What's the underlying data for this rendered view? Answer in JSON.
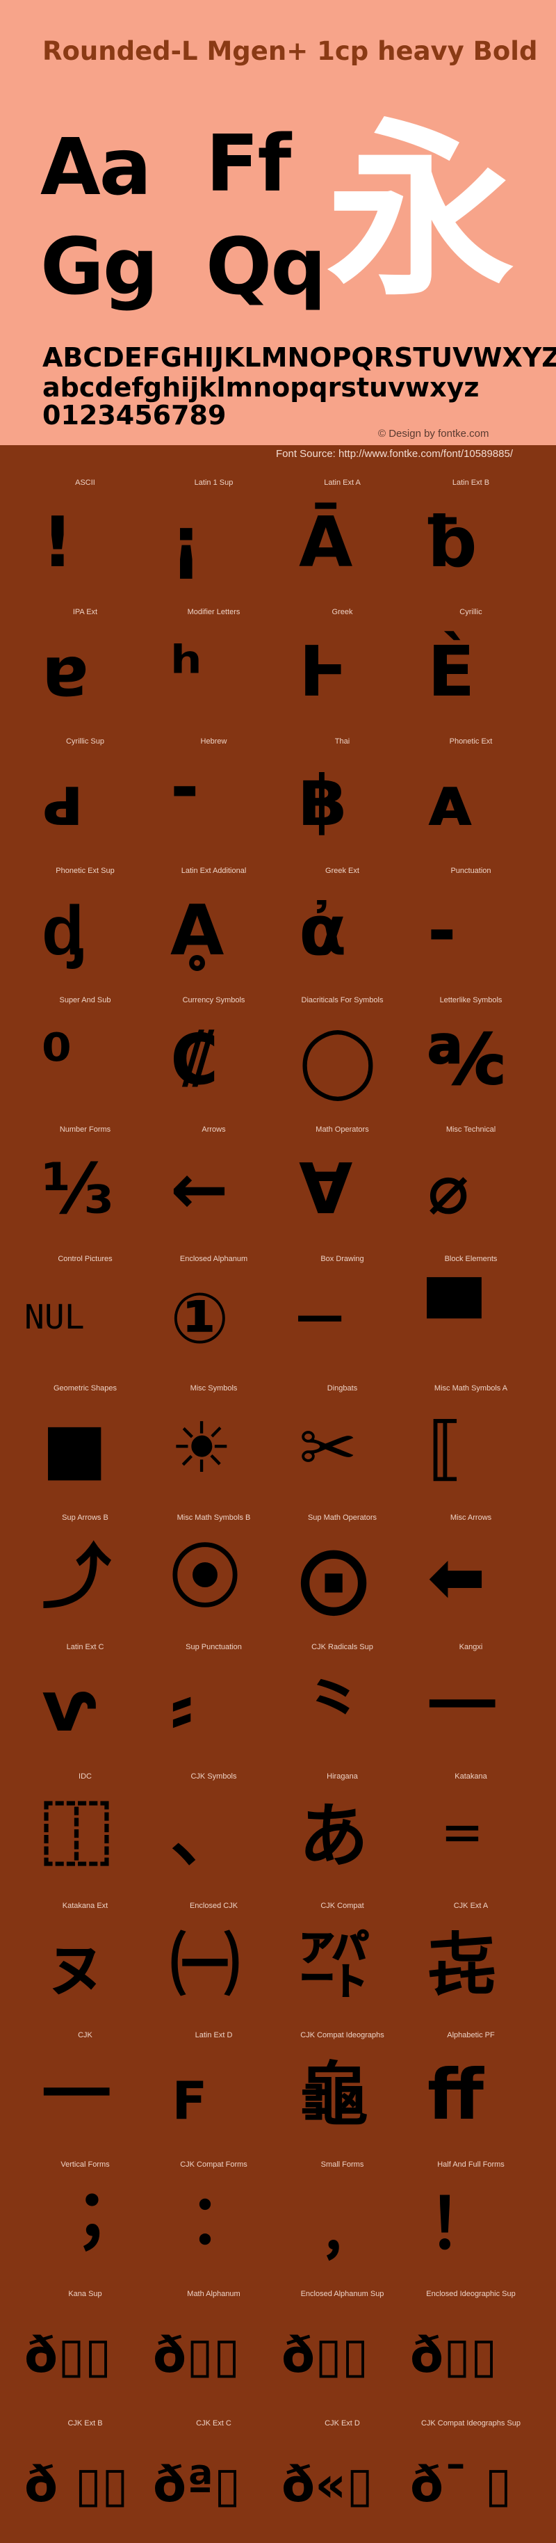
{
  "header": {
    "title": "Rounded-L Mgen+ 1cp heavy Bold",
    "samples": [
      "Aa",
      "Ff",
      "Gg",
      "Qq"
    ],
    "cjk_sample": "永",
    "uppercase": "ABCDEFGHIJKLMNOPQRSTUVWXYZ",
    "lowercase": "abcdefghijklmnopqrstuvwxyz",
    "digits": "0123456789",
    "credit": "© Design by fontke.com",
    "source": "Font Source: http://www.fontke.com/font/10589885/"
  },
  "colors": {
    "header_bg": "#F7A48A",
    "body_bg": "#843513",
    "title": "#8A3A15",
    "cjk_sample": "#FFFFFF"
  },
  "blocks": [
    {
      "label": "ASCII",
      "glyph": "!"
    },
    {
      "label": "Latin 1 Sup",
      "glyph": "¡"
    },
    {
      "label": "Latin Ext A",
      "glyph": "Ā"
    },
    {
      "label": "Latin Ext B",
      "glyph": "ƀ"
    },
    {
      "label": "IPA Ext",
      "glyph": "ɐ"
    },
    {
      "label": "Modifier Letters",
      "glyph": "ʰ"
    },
    {
      "label": "Greek",
      "glyph": "Ͱ"
    },
    {
      "label": "Cyrillic",
      "glyph": "Ѐ"
    },
    {
      "label": "Cyrillic Sup",
      "glyph": "ԁ"
    },
    {
      "label": "Hebrew",
      "glyph": "־"
    },
    {
      "label": "Thai",
      "glyph": "฿"
    },
    {
      "label": "Phonetic Ext",
      "glyph": "ᴀ"
    },
    {
      "label": "Phonetic Ext Sup",
      "glyph": "ᶁ"
    },
    {
      "label": "Latin Ext Additional",
      "glyph": "Ḁ"
    },
    {
      "label": "Greek Ext",
      "glyph": "ἀ"
    },
    {
      "label": "Punctuation",
      "glyph": "‐"
    },
    {
      "label": "Super And Sub",
      "glyph": "⁰"
    },
    {
      "label": "Currency Symbols",
      "glyph": "₡"
    },
    {
      "label": "Diacriticals For Symbols",
      "glyph": "◯"
    },
    {
      "label": "Letterlike Symbols",
      "glyph": "℀"
    },
    {
      "label": "Number Forms",
      "glyph": "⅓"
    },
    {
      "label": "Arrows",
      "glyph": "←"
    },
    {
      "label": "Math Operators",
      "glyph": "∀"
    },
    {
      "label": "Misc Technical",
      "glyph": "⌀"
    },
    {
      "label": "Control Pictures",
      "glyph": "NUL"
    },
    {
      "label": "Enclosed Alphanum",
      "glyph": "①"
    },
    {
      "label": "Box Drawing",
      "glyph": "─"
    },
    {
      "label": "Block Elements",
      "glyph": "▀"
    },
    {
      "label": "Geometric Shapes",
      "glyph": "■"
    },
    {
      "label": "Misc Symbols",
      "glyph": "☀"
    },
    {
      "label": "Dingbats",
      "glyph": "✂"
    },
    {
      "label": "Misc Math Symbols A",
      "glyph": "⟦"
    },
    {
      "label": "Sup Arrows B",
      "glyph": "⤴"
    },
    {
      "label": "Misc Math Symbols B",
      "glyph": "⦿"
    },
    {
      "label": "Sup Math Operators",
      "glyph": "⨀"
    },
    {
      "label": "Misc Arrows",
      "glyph": "⬅"
    },
    {
      "label": "Latin Ext C",
      "glyph": "ⱱ"
    },
    {
      "label": "Sup Punctuation",
      "glyph": "⸗"
    },
    {
      "label": "CJK Radicals Sup",
      "glyph": "⺀"
    },
    {
      "label": "Kangxi",
      "glyph": "⼀"
    },
    {
      "label": "IDC",
      "glyph": "⿰"
    },
    {
      "label": "CJK Symbols",
      "glyph": "、"
    },
    {
      "label": "Hiragana",
      "glyph": "あ"
    },
    {
      "label": "Katakana",
      "glyph": "゠"
    },
    {
      "label": "Katakana Ext",
      "glyph": "ㇴ"
    },
    {
      "label": "Enclosed CJK",
      "glyph": "㈠"
    },
    {
      "label": "CJK Compat",
      "glyph": "㌀"
    },
    {
      "label": "CJK Ext A",
      "glyph": "㐂"
    },
    {
      "label": "CJK",
      "glyph": "一"
    },
    {
      "label": "Latin Ext D",
      "glyph": "ꜰ"
    },
    {
      "label": "CJK Compat Ideographs",
      "glyph": "龜"
    },
    {
      "label": "Alphabetic PF",
      "glyph": "ﬀ"
    },
    {
      "label": "Vertical Forms",
      "glyph": "︔"
    },
    {
      "label": "CJK Compat Forms",
      "glyph": "︰"
    },
    {
      "label": "Small Forms",
      "glyph": "﹐"
    },
    {
      "label": "Half And Full Forms",
      "glyph": "！"
    },
    {
      "label": "Kana Sup",
      "glyph": "ð▯▯"
    },
    {
      "label": "Math Alphanum",
      "glyph": "ð▯▯"
    },
    {
      "label": "Enclosed Alphanum Sup",
      "glyph": "ð▯▯"
    },
    {
      "label": "Enclosed Ideographic Sup",
      "glyph": "ð▯▯"
    },
    {
      "label": "CJK Ext B",
      "glyph": "ð ▯▯"
    },
    {
      "label": "CJK Ext C",
      "glyph": "ðª▯"
    },
    {
      "label": "CJK Ext D",
      "glyph": "ð«▯"
    },
    {
      "label": "CJK Compat Ideographs Sup",
      "glyph": "ð¯ ▯"
    }
  ]
}
